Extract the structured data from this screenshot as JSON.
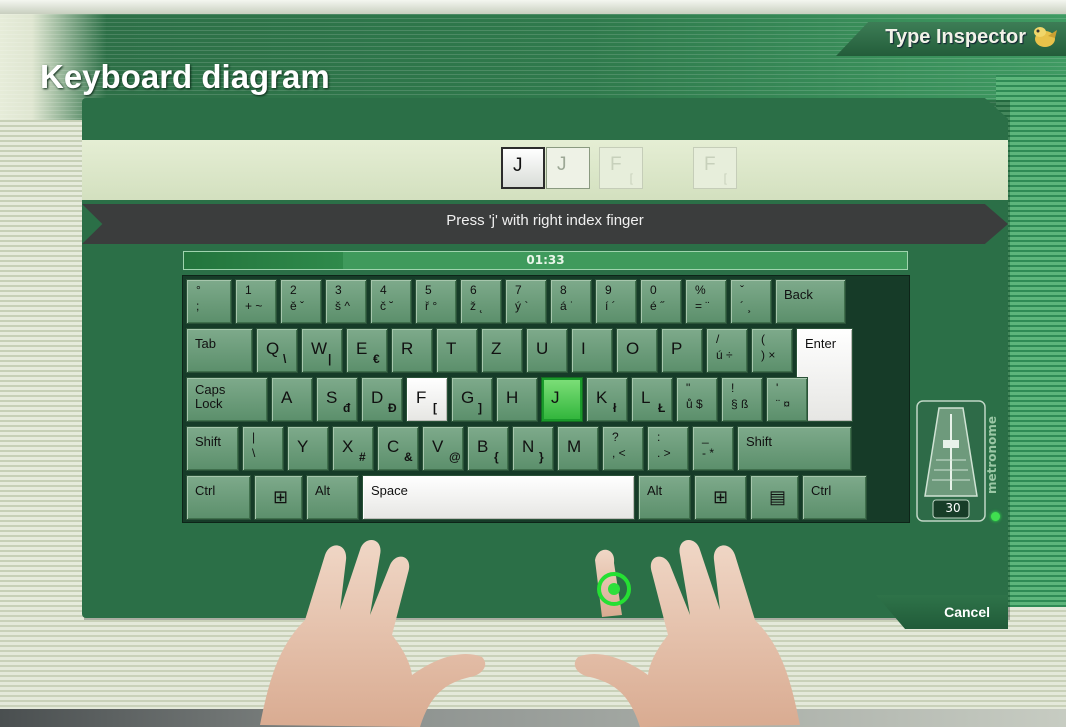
{
  "app": {
    "name": "Type Inspector"
  },
  "page": {
    "title": "Keyboard diagram"
  },
  "sequence": [
    {
      "char": "J",
      "sub": "",
      "state": "active"
    },
    {
      "char": "J",
      "sub": "",
      "state": "next"
    },
    {
      "char": "F",
      "sub": "[",
      "state": "faded"
    },
    {
      "char": "F",
      "sub": "[",
      "state": "faded"
    }
  ],
  "instruction": "Press 'j' with right index finger",
  "timer": {
    "display": "01:33",
    "progress": 0.22
  },
  "keyboard": {
    "row1": [
      {
        "t": "°",
        "b": ";"
      },
      {
        "t": "1",
        "b": "+ ~"
      },
      {
        "t": "2",
        "b": "ě ˇ"
      },
      {
        "t": "3",
        "b": "š ^"
      },
      {
        "t": "4",
        "b": "č ˘"
      },
      {
        "t": "5",
        "b": "ř °"
      },
      {
        "t": "6",
        "b": "ž ˛"
      },
      {
        "t": "7",
        "b": "ý `"
      },
      {
        "t": "8",
        "b": "á ˙"
      },
      {
        "t": "9",
        "b": "í ´"
      },
      {
        "t": "0",
        "b": "é ˝"
      },
      {
        "t": "%",
        "b": "= ¨"
      },
      {
        "t": "ˇ",
        "b": "´ ¸"
      },
      {
        "t": "Back",
        "b": ""
      }
    ],
    "row2": [
      {
        "t": "Tab",
        "b": ""
      },
      {
        "t": "Q",
        "b": "\\"
      },
      {
        "t": "W",
        "b": "|"
      },
      {
        "t": "E",
        "b": "€"
      },
      {
        "t": "R",
        "b": ""
      },
      {
        "t": "T",
        "b": ""
      },
      {
        "t": "Z",
        "b": ""
      },
      {
        "t": "U",
        "b": ""
      },
      {
        "t": "I",
        "b": ""
      },
      {
        "t": "O",
        "b": ""
      },
      {
        "t": "P",
        "b": ""
      },
      {
        "t": "/",
        "b": "ú ÷"
      },
      {
        "t": "(",
        "b": ") ×"
      },
      {
        "t": "Enter",
        "b": ""
      }
    ],
    "row3": [
      {
        "t": "Caps Lock",
        "b": ""
      },
      {
        "t": "A",
        "b": ""
      },
      {
        "t": "S",
        "b": "đ"
      },
      {
        "t": "D",
        "b": "Đ"
      },
      {
        "t": "F",
        "b": "["
      },
      {
        "t": "G",
        "b": "]"
      },
      {
        "t": "H",
        "b": ""
      },
      {
        "t": "J",
        "b": ""
      },
      {
        "t": "K",
        "b": "ł"
      },
      {
        "t": "L",
        "b": "Ł"
      },
      {
        "t": "\"",
        "b": "ů $"
      },
      {
        "t": "!",
        "b": "§ ß"
      },
      {
        "t": "'",
        "b": "¨ ¤"
      }
    ],
    "row4": [
      {
        "t": "Shift",
        "b": ""
      },
      {
        "t": "|",
        "b": "\\"
      },
      {
        "t": "Y",
        "b": ""
      },
      {
        "t": "X",
        "b": "#"
      },
      {
        "t": "C",
        "b": "&"
      },
      {
        "t": "V",
        "b": "@"
      },
      {
        "t": "B",
        "b": "{"
      },
      {
        "t": "N",
        "b": "}"
      },
      {
        "t": "M",
        "b": ""
      },
      {
        "t": "?",
        "b": ", <"
      },
      {
        "t": ":",
        "b": ". >"
      },
      {
        "t": "_",
        "b": "- *"
      },
      {
        "t": "Shift",
        "b": ""
      }
    ],
    "row5": [
      {
        "t": "Ctrl",
        "b": ""
      },
      {
        "t": "⊞",
        "b": ""
      },
      {
        "t": "Alt",
        "b": ""
      },
      {
        "t": "Space",
        "b": ""
      },
      {
        "t": "Alt",
        "b": ""
      },
      {
        "t": "⊞",
        "b": ""
      },
      {
        "t": "▤",
        "b": ""
      },
      {
        "t": "Ctrl",
        "b": ""
      }
    ],
    "highlight": {
      "active": "J",
      "next": "F"
    }
  },
  "metronome": {
    "label": "metronome",
    "value": "30"
  },
  "actions": {
    "cancel": "Cancel"
  },
  "colors": {
    "accent": "#2fb43a",
    "panel": "#2b6f47",
    "dark_bar": "#3b3d3d"
  }
}
